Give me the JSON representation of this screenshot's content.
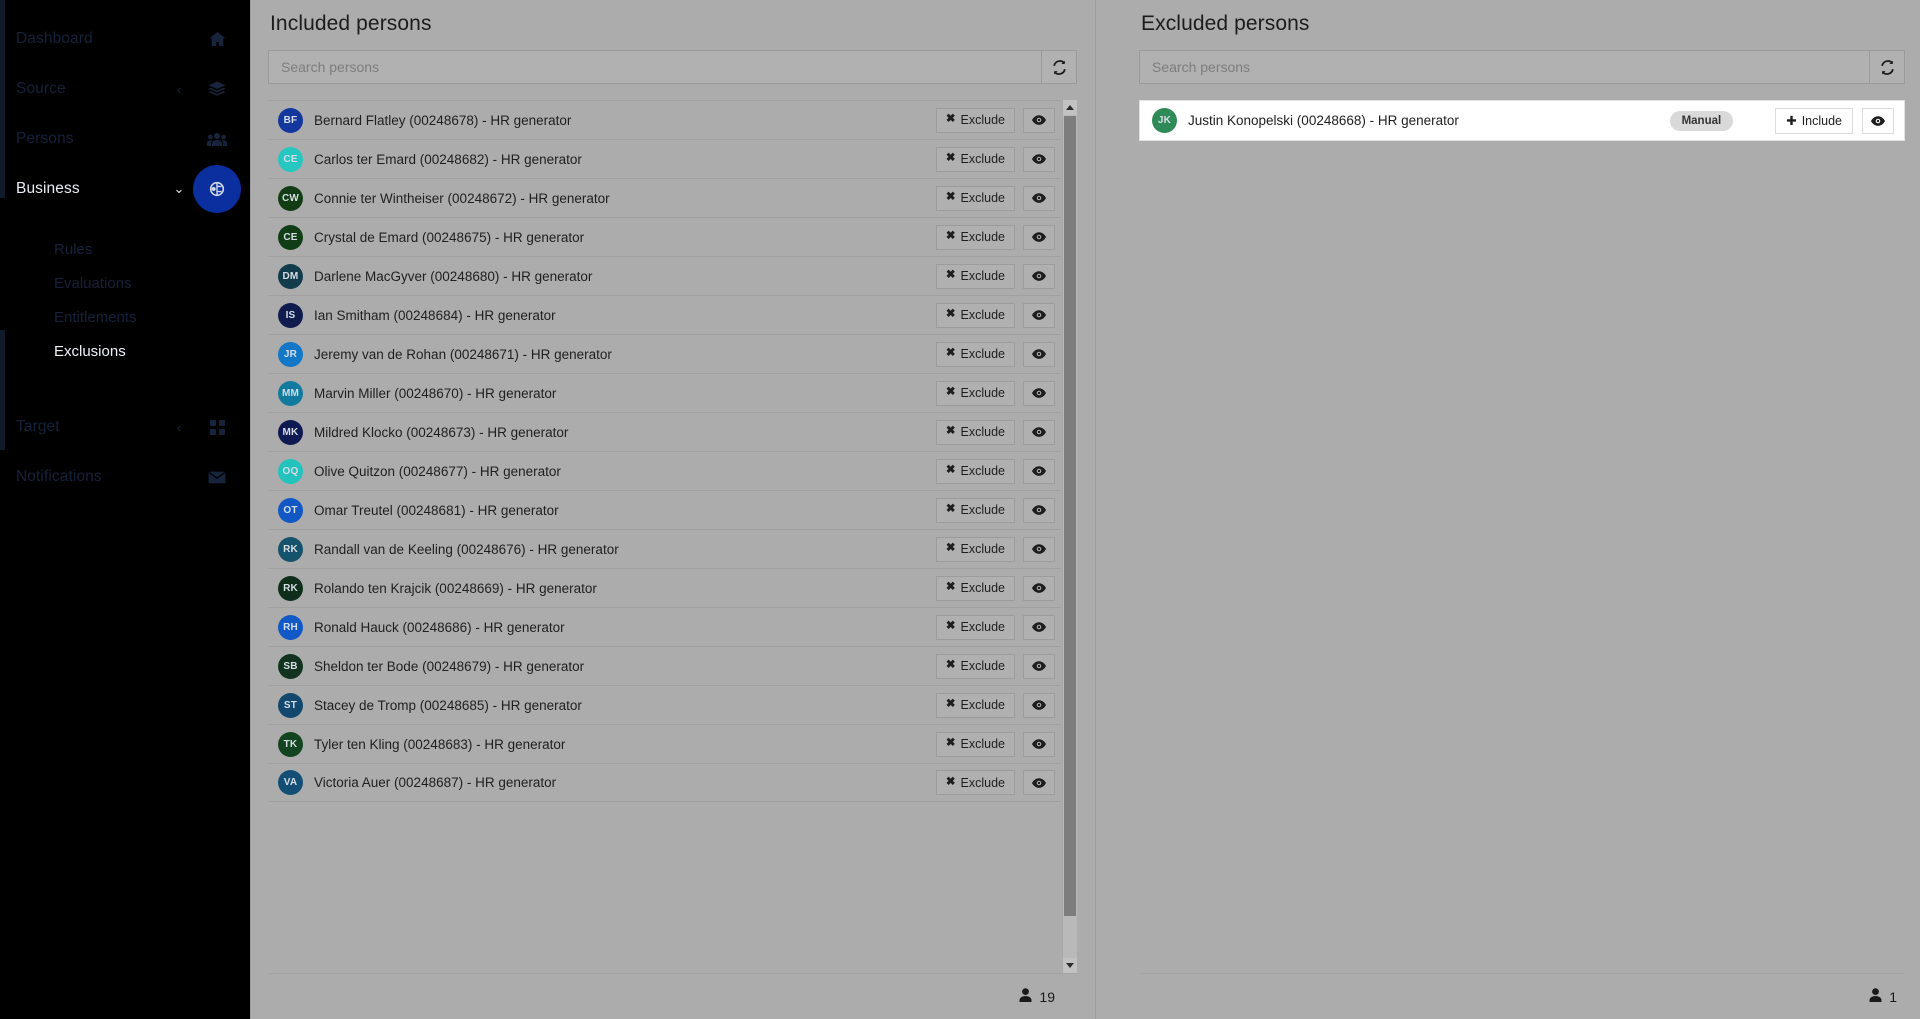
{
  "sidebar": {
    "items": [
      {
        "label": "Dashboard",
        "icon": "home-icon",
        "chevron": "",
        "active": false,
        "bubble": false
      },
      {
        "label": "Source",
        "icon": "layers-icon",
        "chevron": "‹",
        "active": false,
        "bubble": false
      },
      {
        "label": "Persons",
        "icon": "people-icon",
        "chevron": "",
        "active": false,
        "bubble": false
      },
      {
        "label": "Business",
        "icon": "business-icon",
        "chevron": "⌄",
        "active": true,
        "bubble": true
      },
      {
        "label": "Target",
        "icon": "grid-icon",
        "chevron": "‹",
        "active": false,
        "bubble": false
      },
      {
        "label": "Notifications",
        "icon": "envelope-icon",
        "chevron": "",
        "active": false,
        "bubble": false
      }
    ],
    "sub_items": [
      {
        "label": "Rules",
        "active": false
      },
      {
        "label": "Evaluations",
        "active": false
      },
      {
        "label": "Entitlements",
        "active": false
      },
      {
        "label": "Exclusions",
        "active": true
      }
    ],
    "accent_color": "#0b2f9e",
    "dim_color": "#16213a",
    "active_color": "#e9ecf2"
  },
  "included_panel": {
    "title": "Included persons",
    "search": {
      "value": "",
      "placeholder": "Search persons"
    },
    "refresh_icon": "refresh-icon",
    "exclude_label": "Exclude",
    "exclude_glyph": "✖",
    "eye_icon": "eye-icon",
    "count": "19",
    "count_icon": "person-icon",
    "rows": [
      {
        "initials": "BF",
        "color": "#14379e",
        "label": "Bernard Flatley (00248678) - HR generator"
      },
      {
        "initials": "CE",
        "color": "#25c7c0",
        "label": "Carlos ter Emard (00248682) - HR generator"
      },
      {
        "initials": "CW",
        "color": "#123d14",
        "label": "Connie ter Wintheiser (00248672) - HR generator"
      },
      {
        "initials": "CE",
        "color": "#113d16",
        "label": "Crystal de Emard (00248675) - HR generator"
      },
      {
        "initials": "DM",
        "color": "#123b4c",
        "label": "Darlene MacGyver (00248680) - HR generator"
      },
      {
        "initials": "IS",
        "color": "#101c4e",
        "label": "Ian Smitham (00248684) - HR generator"
      },
      {
        "initials": "JR",
        "color": "#1377c7",
        "label": "Jeremy van de Rohan (00248671) - HR generator"
      },
      {
        "initials": "MM",
        "color": "#127a9e",
        "label": "Marvin Miller (00248670) - HR generator"
      },
      {
        "initials": "MK",
        "color": "#101a52",
        "label": "Mildred Klocko (00248673) - HR generator"
      },
      {
        "initials": "OQ",
        "color": "#21c3bc",
        "label": "Olive Quitzon (00248677) - HR generator"
      },
      {
        "initials": "OT",
        "color": "#1158c4",
        "label": "Omar Treutel (00248681) - HR generator"
      },
      {
        "initials": "RK",
        "color": "#14536b",
        "label": "Randall van de Keeling (00248676) - HR generator"
      },
      {
        "initials": "RK",
        "color": "#0e2e1b",
        "label": "Rolando ten Krajcik (00248669) - HR generator"
      },
      {
        "initials": "RH",
        "color": "#1159c6",
        "label": "Ronald Hauck (00248686) - HR generator"
      },
      {
        "initials": "SB",
        "color": "#11331f",
        "label": "Sheldon ter Bode (00248679) - HR generator"
      },
      {
        "initials": "ST",
        "color": "#12486e",
        "label": "Stacey de Tromp (00248685) - HR generator"
      },
      {
        "initials": "TK",
        "color": "#11441f",
        "label": "Tyler ten Kling (00248683) - HR generator"
      },
      {
        "initials": "VA",
        "color": "#134f75",
        "label": "Victoria Auer (00248687) - HR generator"
      }
    ]
  },
  "excluded_panel": {
    "title": "Excluded persons",
    "search": {
      "value": "",
      "placeholder": "Search persons"
    },
    "refresh_icon": "refresh-icon",
    "include_label": "Include",
    "include_glyph": "✚",
    "eye_icon": "eye-icon",
    "count": "1",
    "count_icon": "person-icon",
    "rows": [
      {
        "initials": "JK",
        "color": "#2e8b57",
        "badge": "Manual",
        "label": "Justin Konopelski (00248668) - HR generator"
      }
    ]
  },
  "scrollbar": {
    "up_icon": "chevron-up-icon",
    "down_icon": "chevron-down-icon"
  }
}
